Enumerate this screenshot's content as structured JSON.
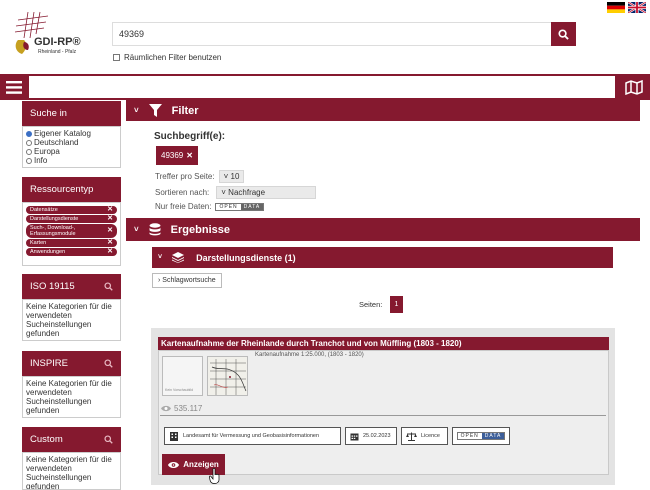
{
  "header": {
    "logo_title": "GDI-RP®",
    "logo_subtitle": "Rheinland - Pfalz",
    "search_value": "49369",
    "spatial_filter_label": "Räumlichen Filter benutzen"
  },
  "sidebar": {
    "search_in": {
      "title": "Suche in",
      "options": [
        "Eigener Katalog",
        "Deutschland",
        "Europa",
        "Info"
      ],
      "selected": "Eigener Katalog"
    },
    "resource_type": {
      "title": "Ressourcentyp",
      "items": [
        "Datensätze",
        "Darstellungsdienste",
        "Such-, Download-, Erfassungsmodule",
        "Karten",
        "Anwendungen"
      ]
    },
    "iso": {
      "title": "ISO 19115",
      "empty_text": "Keine Kategorien für die verwendeten Sucheinstellungen gefunden"
    },
    "inspire": {
      "title": "INSPIRE",
      "empty_text": "Keine Kategorien für die verwendeten Sucheinstellungen gefunden"
    },
    "custom": {
      "title": "Custom",
      "empty_text": "Keine Kategorien für die verwendeten Sucheinstellungen gefunden"
    }
  },
  "filter": {
    "title": "Filter",
    "search_term_label": "Suchbegriff(e):",
    "search_term": "49369",
    "per_page_label": "Treffer pro Seite:",
    "per_page_value": "10",
    "sort_label": "Sortieren nach:",
    "sort_value": "Nachfrage",
    "open_data_label": "Nur freie Daten:",
    "open_word": "OPEN",
    "data_word": "DATA"
  },
  "results": {
    "title": "Ergebnisse",
    "section_title": "Darstellungsdienste (1)",
    "keyword_button": "Schlagwortsuche",
    "pages_label": "Seiten:",
    "current_page": "1",
    "card": {
      "title": "Kartenaufnahme der Rheinlande durch Tranchot und von Müffling (1803 - 1820)",
      "description": "Kartenaufnahme 1:25.000, (1803 - 1820)",
      "thumb_text": "Kein Vorschaubild",
      "views": "535.117",
      "provider": "Landesamt für Vermessung und Geobasisinformationen",
      "date": "25.02.2023",
      "licence": "Licence",
      "open_word": "OPEN",
      "data_word": "DATA",
      "show_button": "Anzeigen"
    }
  },
  "colors": {
    "accent": "#85192f",
    "blue_radio": "#3b6fc4"
  }
}
